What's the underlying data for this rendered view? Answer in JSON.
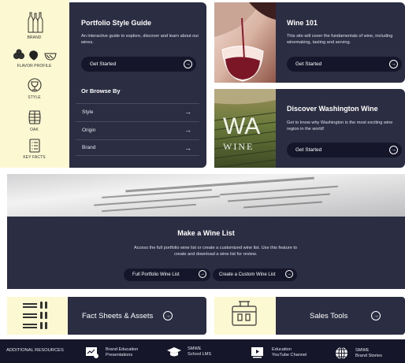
{
  "sidebar": {
    "items": [
      {
        "label": "BRAND",
        "icon": "wine-bottles-icon"
      },
      {
        "label": "FLAVOR PROFILE",
        "icon": "fruit-icon"
      },
      {
        "label": "STYLE",
        "icon": "wine-glass-icon"
      },
      {
        "label": "OAK",
        "icon": "barrel-icon"
      },
      {
        "label": "KEY FACTS",
        "icon": "document-list-icon"
      }
    ]
  },
  "portfolio": {
    "title": "Portfolio Style Guide",
    "description": "An interactive guide to explore, discover and learn about our wines.",
    "button": "Get Started"
  },
  "browse": {
    "title": "Or Browse By",
    "items": [
      "Style",
      "Origin",
      "Brand"
    ]
  },
  "wine101": {
    "title": "Wine 101",
    "description": "This site will cover the fundamentals of wine, including winemaking, tasting and serving.",
    "button": "Get Started"
  },
  "washington": {
    "title": "Discover Washington Wine",
    "description": "Get to know why Washington is the most exciting wine region in the world!",
    "button": "Get Started",
    "logo_big": "WA",
    "logo_small": "WINE"
  },
  "winelist": {
    "title": "Make a Wine List",
    "description": "Access the full portfolio wine list or create a customized wine list. Use this feature to create and download a wine list for review.",
    "buttons": [
      "Full Portfolio Wine List",
      "Create a Custom Wine List"
    ]
  },
  "factsheets": {
    "label": "Fact Sheets & Assets"
  },
  "salestools": {
    "label": "Sales Tools"
  },
  "footer": {
    "title": "ADDITIONAL RESOURCES",
    "items": [
      {
        "line1": "Brand Education",
        "line2": "Presentations",
        "icon": "presentation-icon"
      },
      {
        "line1": "SMWE",
        "line2": "School LMS",
        "icon": "graduation-cap-icon"
      },
      {
        "line1": "Education",
        "line2": "YouTube Channel",
        "icon": "video-play-icon"
      },
      {
        "line1": "SMWE",
        "line2": "Brand Stories",
        "icon": "globe-icon"
      }
    ]
  },
  "colors": {
    "navy": "#2b2d43",
    "dark": "#15162a",
    "cream": "#fbf8d2"
  }
}
